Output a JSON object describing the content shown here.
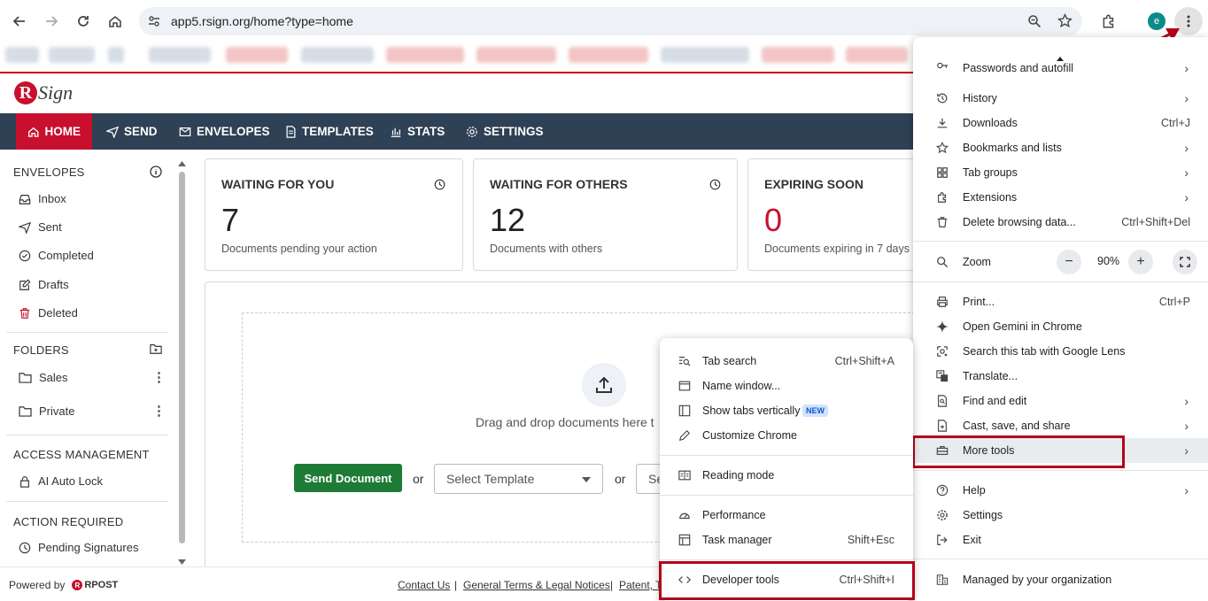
{
  "browser": {
    "url": "app5.rsign.org/home?type=home",
    "avatar_letter": "e"
  },
  "app": {
    "logo_letter": "R",
    "logo_text": "Sign",
    "nav": [
      {
        "label": "HOME",
        "icon": "home-icon",
        "active": true
      },
      {
        "label": "SEND",
        "icon": "send-icon"
      },
      {
        "label": "ENVELOPES",
        "icon": "envelope-icon"
      },
      {
        "label": "TEMPLATES",
        "icon": "template-icon"
      },
      {
        "label": "STATS",
        "icon": "stats-icon"
      },
      {
        "label": "SETTINGS",
        "icon": "settings-icon"
      }
    ]
  },
  "sidebar": {
    "envelopes_header": "ENVELOPES",
    "envelopes": [
      {
        "label": "Inbox",
        "icon": "inbox-icon"
      },
      {
        "label": "Sent",
        "icon": "sent-icon"
      },
      {
        "label": "Completed",
        "icon": "check-circle-icon"
      },
      {
        "label": "Drafts",
        "icon": "edit-icon"
      },
      {
        "label": "Deleted",
        "icon": "trash-icon"
      }
    ],
    "folders_header": "FOLDERS",
    "folders": [
      {
        "label": "Sales",
        "icon": "folder-icon"
      },
      {
        "label": "Private",
        "icon": "folder-icon"
      }
    ],
    "access_header": "ACCESS MANAGEMENT",
    "access": [
      {
        "label": "AI Auto Lock",
        "icon": "lock-icon"
      }
    ],
    "action_header": "ACTION REQUIRED",
    "action": [
      {
        "label": "Pending Signatures",
        "icon": "clock-icon"
      }
    ]
  },
  "cards": [
    {
      "title": "WAITING FOR YOU",
      "count": "7",
      "desc": "Documents pending your action"
    },
    {
      "title": "WAITING FOR OTHERS",
      "count": "12",
      "desc": "Documents with others"
    },
    {
      "title": "EXPIRING SOON",
      "count": "0",
      "desc": "Documents expiring in 7 days"
    }
  ],
  "upload": {
    "drag_text": "Drag and drop documents here t",
    "send_button": "Send Document",
    "or": "or",
    "select_template": "Select Template",
    "select_other": "Se"
  },
  "footer": {
    "powered_by": "Powered by",
    "brand": "RPOST",
    "links": [
      "Contact Us",
      "General Terms & Legal Notices",
      "Patent, T"
    ]
  },
  "chrome_menu": {
    "items_top": [
      {
        "label": "Passwords and autofill",
        "icon": "key-icon",
        "arrow": true
      },
      {
        "label": "History",
        "icon": "history-icon",
        "arrow": true
      },
      {
        "label": "Downloads",
        "icon": "download-icon",
        "shortcut": "Ctrl+J"
      },
      {
        "label": "Bookmarks and lists",
        "icon": "star-icon",
        "arrow": true
      },
      {
        "label": "Tab groups",
        "icon": "tab-groups-icon",
        "arrow": true
      },
      {
        "label": "Extensions",
        "icon": "puzzle-icon",
        "arrow": true
      },
      {
        "label": "Delete browsing data...",
        "icon": "trash-icon",
        "shortcut": "Ctrl+Shift+Del"
      }
    ],
    "zoom_label": "Zoom",
    "zoom_value": "90%",
    "items_mid": [
      {
        "label": "Print...",
        "icon": "print-icon",
        "shortcut": "Ctrl+P"
      },
      {
        "label": "Open Gemini in Chrome",
        "icon": "gemini-icon"
      },
      {
        "label": "Search this tab with Google Lens",
        "icon": "lens-icon"
      },
      {
        "label": "Translate...",
        "icon": "translate-icon"
      },
      {
        "label": "Find and edit",
        "icon": "find-icon",
        "arrow": true
      },
      {
        "label": "Cast, save, and share",
        "icon": "cast-icon",
        "arrow": true
      },
      {
        "label": "More tools",
        "icon": "toolbox-icon",
        "arrow": true
      }
    ],
    "items_bottom": [
      {
        "label": "Help",
        "icon": "help-icon",
        "arrow": true
      },
      {
        "label": "Settings",
        "icon": "gear-icon"
      },
      {
        "label": "Exit",
        "icon": "exit-icon"
      }
    ],
    "managed": "Managed by your organization"
  },
  "submenu": {
    "items": [
      {
        "label": "Tab search",
        "icon": "tab-search-icon",
        "shortcut": "Ctrl+Shift+A"
      },
      {
        "label": "Name window...",
        "icon": "window-icon"
      },
      {
        "label": "Show tabs vertically",
        "icon": "vertical-tabs-icon",
        "badge": "NEW"
      },
      {
        "label": "Customize Chrome",
        "icon": "pencil-icon"
      },
      {
        "label": "Reading mode",
        "icon": "reading-icon"
      },
      {
        "label": "Performance",
        "icon": "gauge-icon"
      },
      {
        "label": "Task manager",
        "icon": "task-manager-icon",
        "shortcut": "Shift+Esc"
      },
      {
        "label": "Developer tools",
        "icon": "code-icon",
        "shortcut": "Ctrl+Shift+I"
      }
    ]
  },
  "colors": {
    "brand_red": "#c8102e",
    "nav_bg": "#2f4154",
    "send_green": "#1e7b35",
    "highlight": "#b3001b"
  }
}
